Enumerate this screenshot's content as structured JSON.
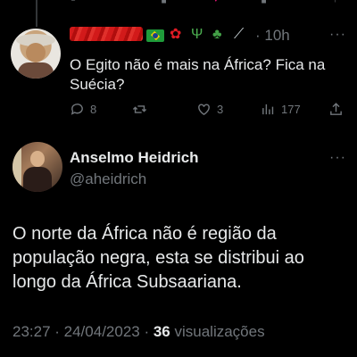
{
  "reply": {
    "time": "· 10h",
    "text": "O Egito não é mais na África? Fica na Suécia?",
    "actions": {
      "replies": "8",
      "retweets": "",
      "likes": "3",
      "views": "177"
    },
    "emoji_icons": [
      "brazil-flag-icon",
      "rose-icon",
      "cactus-icon",
      "clover-icon",
      "knife-icon"
    ]
  },
  "tweet": {
    "name": "Anselmo Heidrich",
    "handle": "@aheidrich",
    "text": "O norte da África não é região da população negra, esta se distribui ao longo da África Subsaariana.",
    "time": "23:27 · 24/04/2023 · ",
    "views_count": "36",
    "views_label": " visualizações"
  },
  "colors": {
    "background": "#000000",
    "text": "#e7e9ea",
    "muted": "#71767b",
    "redaction": "#d21a1a"
  }
}
